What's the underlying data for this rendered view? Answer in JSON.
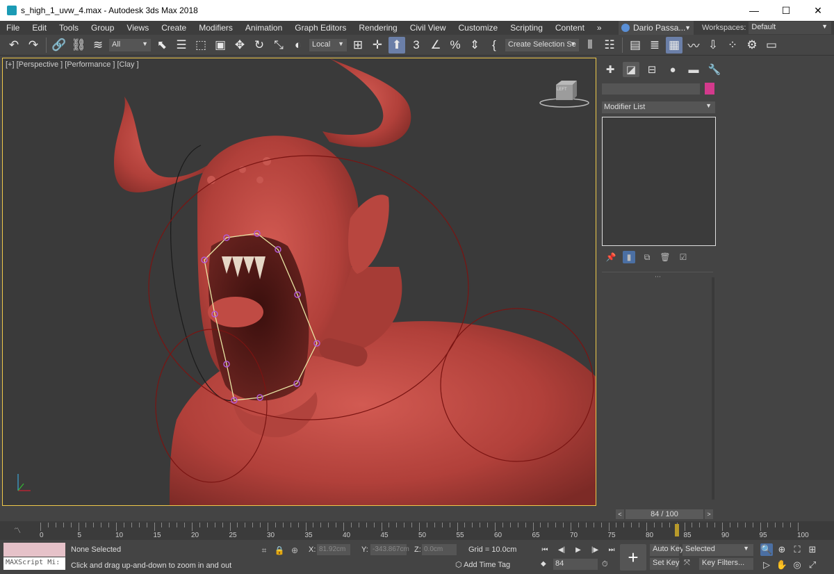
{
  "window": {
    "title": "s_high_1_uvw_4.max - Autodesk 3ds Max 2018",
    "minimize": "—",
    "maximize": "☐",
    "close": "✕"
  },
  "menu": {
    "items": [
      "File",
      "Edit",
      "Tools",
      "Group",
      "Views",
      "Create",
      "Modifiers",
      "Animation",
      "Graph Editors",
      "Rendering",
      "Civil View",
      "Customize",
      "Scripting",
      "Content"
    ],
    "overflow": "»",
    "user": "Dario Passa...",
    "workspaces_label": "Workspaces:",
    "workspace": "Default"
  },
  "toolbar": {
    "filter": "All",
    "coord_system": "Local",
    "selection_set": "Create Selection Se"
  },
  "viewport": {
    "label": "[+] [Perspective ] [Performance ] [Clay ]",
    "viewcube_label": "LEFT"
  },
  "command_panel": {
    "modifier_list": "Modifier List",
    "object_color": "#d33a8c"
  },
  "timeline": {
    "frame_display": "84 / 100",
    "current_frame": 84,
    "ticks": [
      0,
      5,
      10,
      15,
      20,
      25,
      30,
      35,
      40,
      45,
      50,
      55,
      60,
      65,
      70,
      75,
      80,
      85,
      90,
      95,
      100
    ]
  },
  "status": {
    "maxscript_placeholder": "MAXScript Mi:",
    "selection": "None Selected",
    "prompt": "Click and drag up-and-down to zoom in and out",
    "x_label": "X:",
    "x_value": "81.92cm",
    "y_label": "Y:",
    "y_value": "-343.867cm",
    "z_label": "Z:",
    "z_value": "0.0cm",
    "grid": "Grid = 10.0cm",
    "add_time_tag": "Add Time Tag",
    "frame_field": "84",
    "auto_key": "Auto Key",
    "set_key": "Set Key",
    "key_mode": "Selected",
    "key_filters": "Key Filters..."
  },
  "colors": {
    "viewport_border": "#f0c94a",
    "model_red": "#c0463f",
    "accent_blue": "#4b6fa3"
  }
}
